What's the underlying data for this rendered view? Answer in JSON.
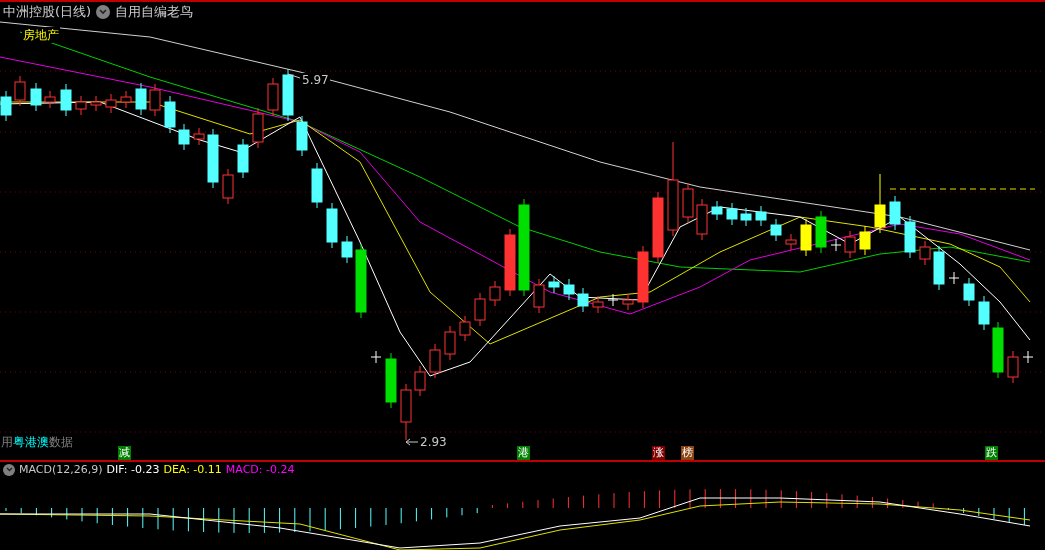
{
  "header": {
    "title": "中洲控股(日线)",
    "indicator": "自用自编老鸟"
  },
  "sector_label": "房地产",
  "price_labels": [
    {
      "text": "5.97",
      "kind": "high"
    },
    {
      "text": "2.93",
      "kind": "low"
    }
  ],
  "data_label": {
    "prefix": "用",
    "highlight": "粤港澳",
    "suffix": "数据"
  },
  "signals": [
    {
      "text": "减",
      "color": "#008000"
    },
    {
      "text": "港",
      "color": "#008000"
    },
    {
      "text": "涨",
      "color": "#800000"
    },
    {
      "text": "榜",
      "color": "#8b4513"
    },
    {
      "text": "跌",
      "color": "#008000"
    }
  ],
  "macd": {
    "name": "MACD(12,26,9)",
    "dif": "DIF: -0.23",
    "dea": "DEA: -0.11",
    "macd": "MACD: -0.24"
  }
}
